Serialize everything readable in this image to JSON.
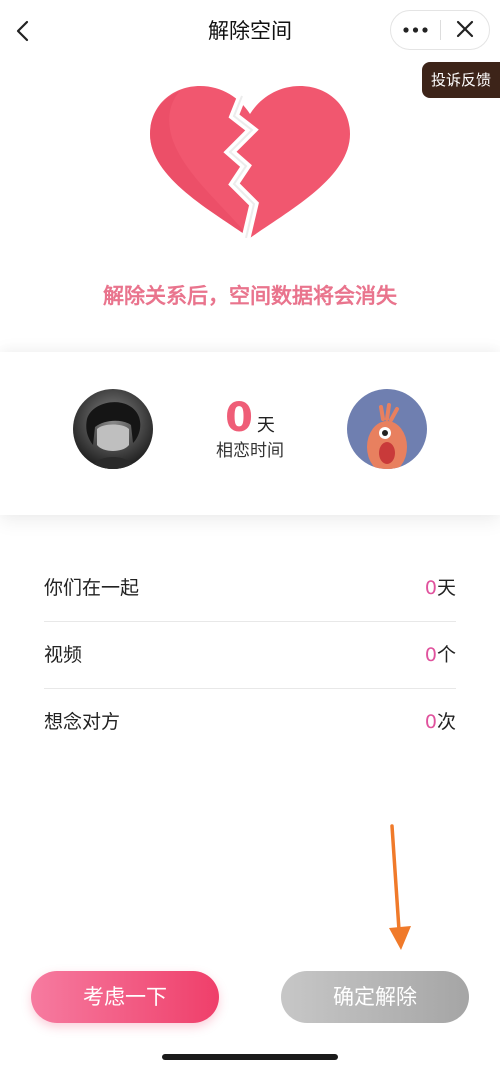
{
  "header": {
    "title": "解除空间",
    "back_icon": "chevron-left-icon",
    "more_icon": "more-dots-icon",
    "close_icon": "close-icon"
  },
  "complaint_label": "投诉反馈",
  "warning_text": "解除关系后，空间数据将会消失",
  "couple": {
    "days": "0",
    "days_unit": "天",
    "days_label": "相恋时间"
  },
  "stats": [
    {
      "label": "你们在一起",
      "value": "0",
      "unit": "天"
    },
    {
      "label": "视频",
      "value": "0",
      "unit": "个"
    },
    {
      "label": "想念对方",
      "value": "0",
      "unit": "次"
    }
  ],
  "buttons": {
    "consider": "考虑一下",
    "confirm": "确定解除"
  },
  "colors": {
    "heart": "#f1576f",
    "warning": "#e9748d",
    "accent": "#ef5d77",
    "stat_number": "#e0529d",
    "arrow": "#f07a2a",
    "complaint_bg": "#3d2419"
  }
}
